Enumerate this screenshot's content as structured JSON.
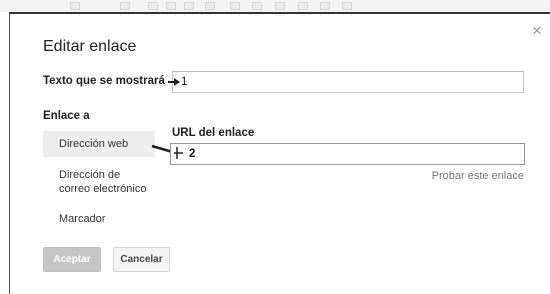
{
  "dialog": {
    "title": "Editar enlace",
    "close_glyph": "×"
  },
  "display_text": {
    "label": "Texto que se mostrará",
    "value": "1"
  },
  "link_section": {
    "label": "Enlace a",
    "items": [
      {
        "label": "Dirección web",
        "selected": true
      },
      {
        "label_line1": "Dirección de",
        "label_line2": "correo electrónico",
        "selected": false
      },
      {
        "label": "Marcador",
        "selected": false
      }
    ]
  },
  "url": {
    "label": "URL del enlace",
    "value": "2",
    "test_link": "Probar este enlace"
  },
  "buttons": {
    "accept": "Aceptar",
    "cancel": "Cancelar"
  },
  "colors": {
    "accept_disabled_bg": "#c6c6c6",
    "selected_item_bg": "#eeeeee",
    "link_gray": "#777777"
  }
}
